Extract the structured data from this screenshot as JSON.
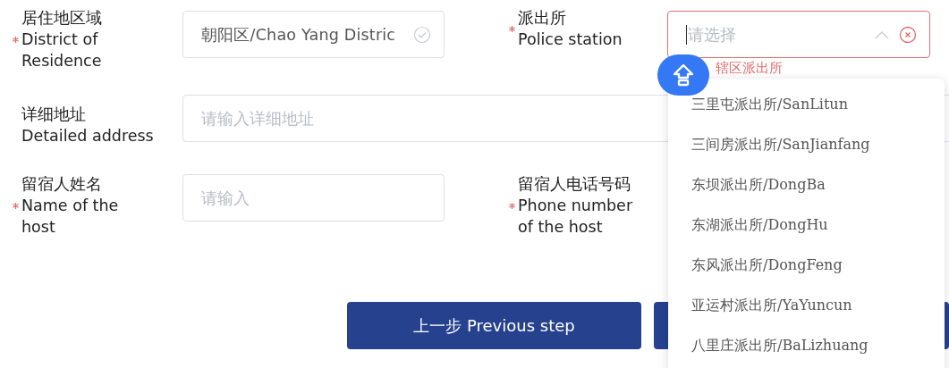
{
  "rows": [
    {
      "fields": [
        {
          "label_zh": "居住地区域",
          "label_en": "District of Residence",
          "required": true,
          "kind": "select",
          "value": "朝阳区/Chao Yang Distric",
          "valid": true
        },
        {
          "label_zh": "派出所",
          "label_en": "Police station",
          "required": true,
          "kind": "dropdown",
          "placeholder": "请选择",
          "error": "辖区派出所",
          "expanded": true
        }
      ]
    },
    {
      "fields": [
        {
          "label_zh": "详细地址",
          "label_en": "Detailed address",
          "required": false,
          "kind": "input",
          "placeholder": "请输入详细地址"
        }
      ]
    },
    {
      "fields": [
        {
          "label_zh": "留宿人姓名",
          "label_en": "Name of the host",
          "required": true,
          "kind": "input",
          "placeholder": "请输入"
        },
        {
          "label_zh": "留宿人电话号码",
          "label_en": "Phone number of the host",
          "required": true,
          "kind": "hidden"
        }
      ]
    }
  ],
  "dropdown_options": [
    {
      "label": "三里屯派出所/SanLitun",
      "selected": false
    },
    {
      "label": "三间房派出所/SanJianfang",
      "selected": false
    },
    {
      "label": "东坝派出所/DongBa",
      "selected": false
    },
    {
      "label": "东湖派出所/DongHu",
      "selected": false
    },
    {
      "label": "东风派出所/DongFeng",
      "selected": false
    },
    {
      "label": "亚运村派出所/YaYuncun",
      "selected": false
    },
    {
      "label": "八里庄派出所/BaLizhuang",
      "selected": false
    }
  ],
  "buttons": [
    {
      "kind": "previous",
      "label": "上一步 Previous step"
    },
    {
      "kind": "next"
    }
  ]
}
